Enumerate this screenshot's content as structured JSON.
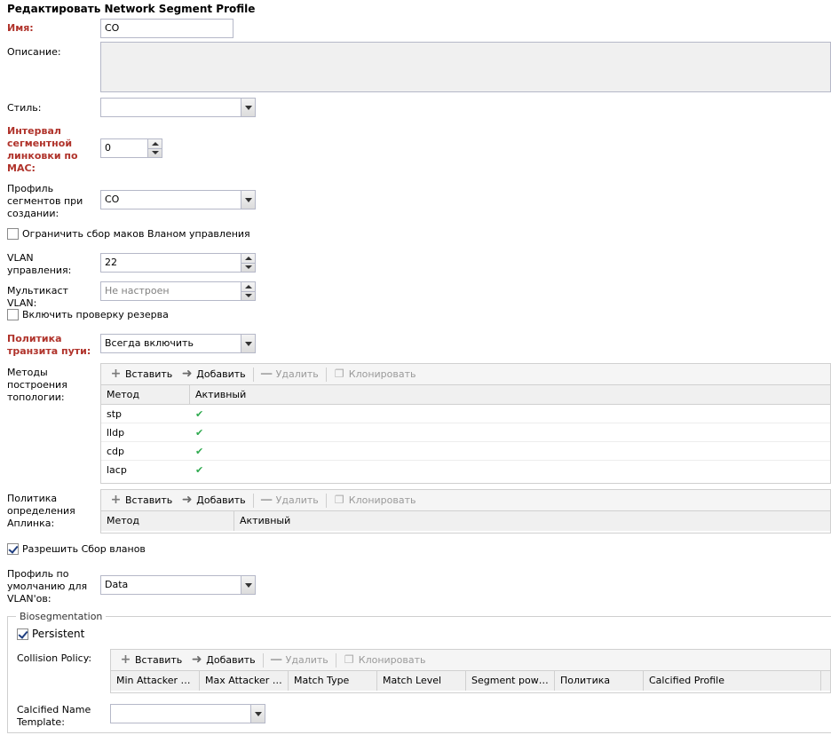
{
  "title": "Редактировать Network Segment Profile",
  "name": {
    "label": "Имя:",
    "value": "CO"
  },
  "description": {
    "label": "Описание:",
    "value": ""
  },
  "style": {
    "label": "Стиль:",
    "value": ""
  },
  "mac_interval": {
    "label": "Интервал сегментной линковки по MAC:",
    "value": "0"
  },
  "segment_profile": {
    "label": "Профиль сегментов при создании:",
    "value": "CO"
  },
  "limit_macs": {
    "label": "Ограничить сбор маков Вланом управления",
    "checked": false
  },
  "mgmt_vlan": {
    "label": "VLAN управления:",
    "value": "22"
  },
  "multicast_vlan": {
    "label": "Мультикаст VLAN:",
    "placeholder": "Не настроен"
  },
  "reserve_check": {
    "label": "Включить проверку резерва",
    "checked": false
  },
  "transit_policy": {
    "label": "Политика транзита пути:",
    "value": "Всегда включить"
  },
  "toolbar": {
    "insert": "Вставить",
    "add": "Добавить",
    "delete": "Удалить",
    "clone": "Клонировать"
  },
  "topology": {
    "label": "Методы построения топологии:",
    "columns": [
      "Метод",
      "Активный"
    ],
    "rows": [
      {
        "method": "stp",
        "active": "✔"
      },
      {
        "method": "lldp",
        "active": "✔"
      },
      {
        "method": "cdp",
        "active": "✔"
      },
      {
        "method": "lacp",
        "active": "✔"
      }
    ]
  },
  "uplink": {
    "label": "Политика определения Аплинка:",
    "columns": [
      "Метод",
      "Активный"
    ]
  },
  "allow_vlans": {
    "label": "Разрешить Сбор вланов",
    "checked": true
  },
  "default_vlan_profile": {
    "label": "Профиль по умолчанию для VLAN'ов:",
    "value": "Data"
  },
  "bio": {
    "legend": "Biosegmentation",
    "persistent": {
      "label": "Persistent",
      "checked": true
    },
    "collision_label": "Collision Policy:",
    "columns": [
      "Min Attacker Lvl",
      "Max Attacker Lvl",
      "Match Type",
      "Match Level",
      "Segment power...",
      "Политика",
      "Calcified Profile"
    ],
    "calcified_label": "Calcified Name Template:",
    "calcified_value": ""
  },
  "colors": {
    "required": "#b0332b",
    "check": "#2faa4f"
  }
}
